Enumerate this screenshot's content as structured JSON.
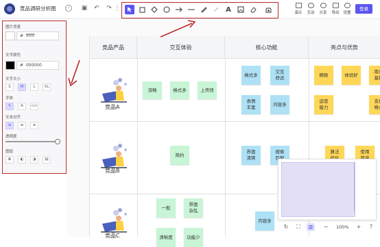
{
  "app": {
    "file_name": "竞品调研分析图"
  },
  "toolbar": {
    "tools": [
      "select-tool",
      "rectangle-tool",
      "diamond-tool",
      "circle-tool",
      "arrow-tool",
      "line-tool",
      "pen-tool",
      "highlighter-tool",
      "text-tool",
      "image-tool",
      "eraser-tool",
      "sticker-tool"
    ],
    "text_tool_glyph": "A",
    "right": [
      {
        "label": "演示",
        "icon": "present-icon"
      },
      {
        "label": "互动",
        "icon": "interact-icon"
      },
      {
        "label": "分享",
        "icon": "share-icon"
      },
      {
        "label": "导出",
        "icon": "export-icon"
      },
      {
        "label": "设置",
        "icon": "settings-icon"
      }
    ],
    "login_label": "登录"
  },
  "left_panel": {
    "bg_label": "图片背景",
    "bg_value": "ffffff",
    "text_color_label": "文字颜色",
    "text_color_value": "000000",
    "text_color_hex": "#000000",
    "font_size_label": "文字大小",
    "font_sizes": [
      "S",
      "M",
      "L",
      "XL"
    ],
    "font_size_selected": "M",
    "font_label": "字体",
    "font_options": [
      "✎",
      "A",
      "</>"
    ],
    "align_label": "文本对齐",
    "align_options": [
      "≡",
      "≡",
      "≡"
    ],
    "opacity_label": "透明度",
    "opacity_value": 1.0,
    "layer_label": "图层",
    "hash": "#"
  },
  "table": {
    "headers": [
      "竞品产品",
      "交互体验",
      "核心功能",
      "亮点与优势"
    ],
    "rows": [
      {
        "name": "竞品A",
        "interaction": [
          "流畅",
          "格式多",
          "上传快"
        ],
        "core": [
          "格式多",
          "交互\n舒适",
          "表情\n丰富",
          "内容多"
        ],
        "highlights": [
          "精致",
          "体验好",
          "用户\n基数",
          "运营\n能力",
          "支持\n格式"
        ]
      },
      {
        "name": "竞品B",
        "interaction": [
          "简约"
        ],
        "core": [
          "界面\n清爽",
          "搜索\n匹配"
        ],
        "highlights": [
          "算法\n优化",
          "使用\n简单"
        ]
      },
      {
        "name": "竞品C",
        "interaction": [
          "一般",
          "界面\n杂乱",
          "清晰度",
          "功能少"
        ],
        "core": [
          "内容多"
        ],
        "highlights": []
      }
    ]
  },
  "zoom": {
    "value": "100%"
  },
  "colors": {
    "accent": "#5b56f2",
    "highlight_red": "#b92a2a",
    "sticky_green": "#c8f5d6",
    "sticky_blue": "#aee1f5",
    "sticky_yellow": "#ffd758"
  }
}
